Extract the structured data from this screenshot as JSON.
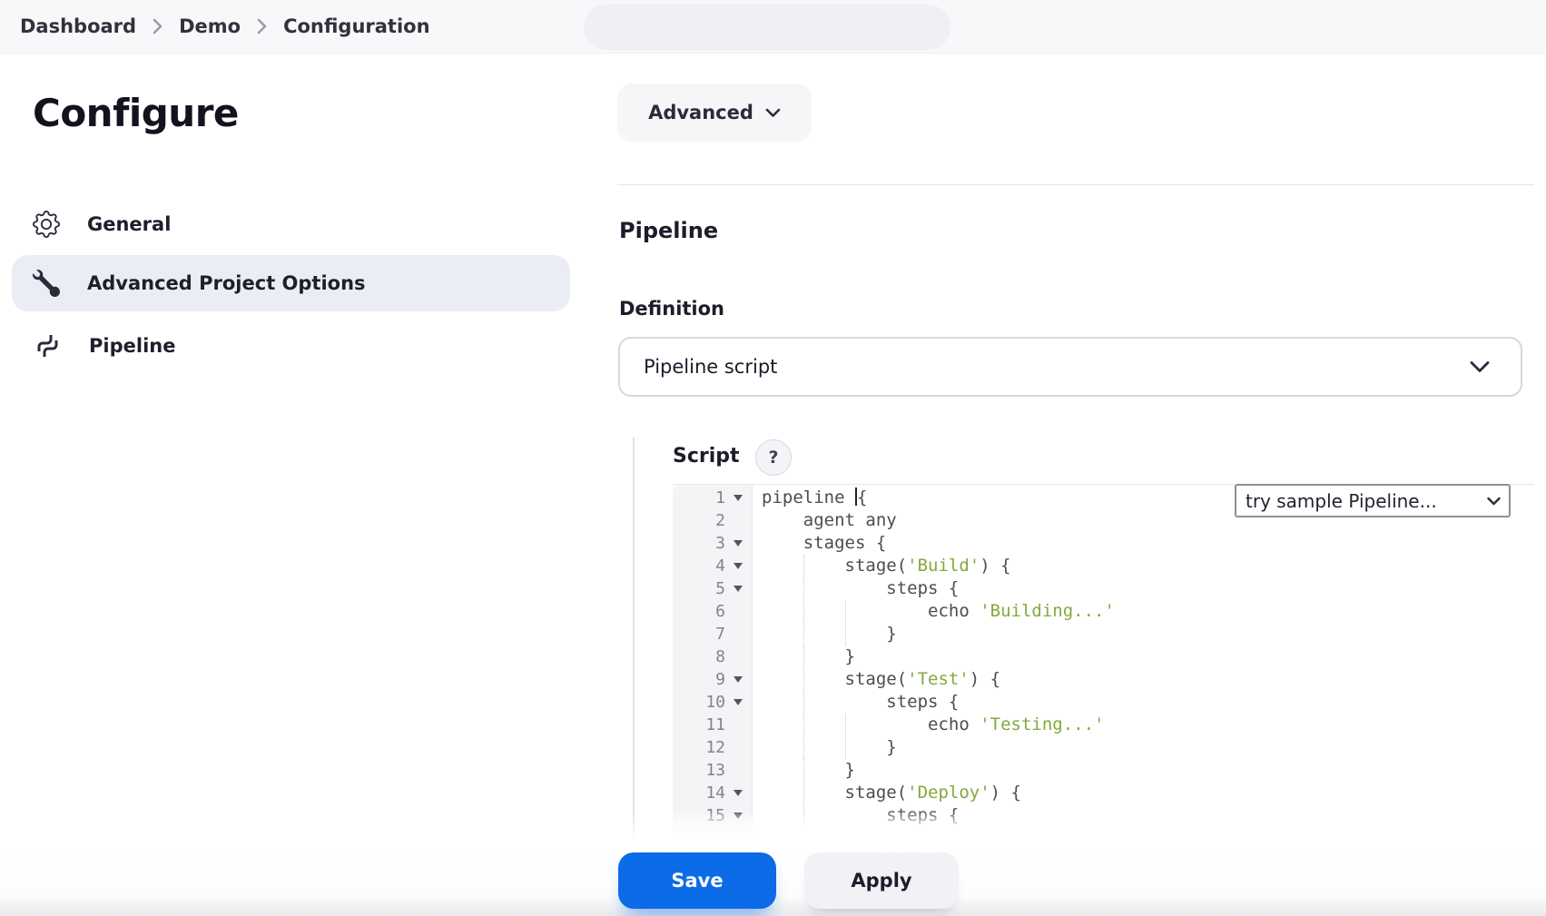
{
  "breadcrumb": {
    "items": [
      "Dashboard",
      "Demo",
      "Configuration"
    ]
  },
  "page": {
    "title": "Configure"
  },
  "sidebar": {
    "items": [
      {
        "label": "General",
        "icon": "gear-icon",
        "active": false
      },
      {
        "label": "Advanced Project Options",
        "icon": "wrench-icon",
        "active": true
      },
      {
        "label": "Pipeline",
        "icon": "pipeline-icon",
        "active": false
      }
    ]
  },
  "main": {
    "advanced_button": "Advanced",
    "section_heading": "Pipeline",
    "definition_label": "Definition",
    "definition_select_value": "Pipeline script",
    "script_label": "Script",
    "help_label": "?",
    "sample_select_value": "try sample Pipeline..."
  },
  "editor": {
    "lines": [
      {
        "num": 1,
        "fold": true,
        "segments": [
          {
            "t": "pipeline ",
            "s": "code"
          },
          {
            "t": "",
            "s": "cursor"
          },
          {
            "t": "{",
            "s": "code"
          }
        ]
      },
      {
        "num": 2,
        "fold": false,
        "segments": [
          {
            "t": "    agent any",
            "s": "code"
          }
        ]
      },
      {
        "num": 3,
        "fold": true,
        "segments": [
          {
            "t": "    stages {",
            "s": "code"
          }
        ]
      },
      {
        "num": 4,
        "fold": true,
        "guides": [
          4
        ],
        "segments": [
          {
            "t": "        stage(",
            "s": "code"
          },
          {
            "t": "'Build'",
            "s": "string"
          },
          {
            "t": ") {",
            "s": "code"
          }
        ]
      },
      {
        "num": 5,
        "fold": true,
        "guides": [
          4
        ],
        "segments": [
          {
            "t": "            steps {",
            "s": "code"
          }
        ]
      },
      {
        "num": 6,
        "fold": false,
        "guides": [
          4,
          8
        ],
        "segments": [
          {
            "t": "                echo ",
            "s": "code"
          },
          {
            "t": "'Building...'",
            "s": "string"
          }
        ]
      },
      {
        "num": 7,
        "fold": false,
        "guides": [
          4,
          8
        ],
        "segments": [
          {
            "t": "            }",
            "s": "code"
          }
        ]
      },
      {
        "num": 8,
        "fold": false,
        "guides": [
          4
        ],
        "segments": [
          {
            "t": "        }",
            "s": "code"
          }
        ]
      },
      {
        "num": 9,
        "fold": true,
        "guides": [
          4
        ],
        "segments": [
          {
            "t": "        stage(",
            "s": "code"
          },
          {
            "t": "'Test'",
            "s": "string"
          },
          {
            "t": ") {",
            "s": "code"
          }
        ]
      },
      {
        "num": 10,
        "fold": true,
        "guides": [
          4
        ],
        "segments": [
          {
            "t": "            steps {",
            "s": "code"
          }
        ]
      },
      {
        "num": 11,
        "fold": false,
        "guides": [
          4,
          8
        ],
        "segments": [
          {
            "t": "                echo ",
            "s": "code"
          },
          {
            "t": "'Testing...'",
            "s": "string"
          }
        ]
      },
      {
        "num": 12,
        "fold": false,
        "guides": [
          4,
          8
        ],
        "segments": [
          {
            "t": "            }",
            "s": "code"
          }
        ]
      },
      {
        "num": 13,
        "fold": false,
        "guides": [
          4
        ],
        "segments": [
          {
            "t": "        }",
            "s": "code"
          }
        ]
      },
      {
        "num": 14,
        "fold": true,
        "guides": [
          4
        ],
        "segments": [
          {
            "t": "        stage(",
            "s": "code"
          },
          {
            "t": "'Deploy'",
            "s": "string"
          },
          {
            "t": ") {",
            "s": "code"
          }
        ]
      },
      {
        "num": 15,
        "fold": true,
        "guides": [
          4
        ],
        "segments": [
          {
            "t": "            steps {",
            "s": "code"
          }
        ]
      }
    ]
  },
  "footer": {
    "save_label": "Save",
    "apply_label": "Apply"
  },
  "colors": {
    "accent_blue": "#0c6be6",
    "string_green": "#84a93d",
    "active_item_bg": "#ebedf4",
    "topbar_bg": "#f8f8fa"
  }
}
